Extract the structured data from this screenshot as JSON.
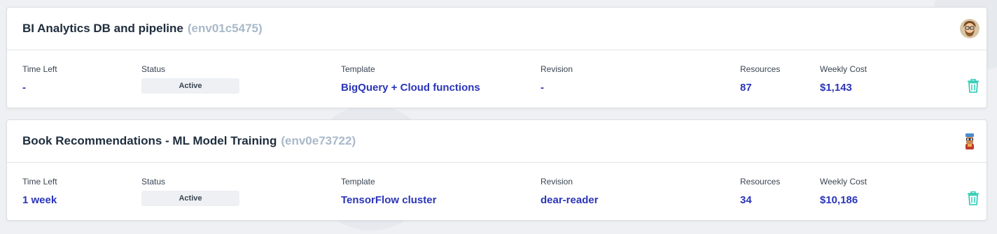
{
  "environments": [
    {
      "name": "BI Analytics DB and pipeline",
      "env_id": "(env01c5475)",
      "avatar_icon": "bearded-man-avatar",
      "labels": {
        "time_left": "Time Left",
        "status": "Status",
        "template": "Template",
        "revision": "Revision",
        "resources": "Resources",
        "weekly_cost": "Weekly Cost"
      },
      "time_left": "-",
      "status": "Active",
      "template": "BigQuery + Cloud functions",
      "revision": "-",
      "resources": "87",
      "weekly_cost": "$1,143"
    },
    {
      "name": "Book Recommendations - ML Model Training",
      "env_id": "(env0e73722)",
      "avatar_icon": "cartoon-character-avatar",
      "labels": {
        "time_left": "Time Left",
        "status": "Status",
        "template": "Template",
        "revision": "Revision",
        "resources": "Resources",
        "weekly_cost": "Weekly Cost"
      },
      "time_left": "1 week",
      "status": "Active",
      "template": "TensorFlow cluster",
      "revision": "dear-reader",
      "resources": "34",
      "weekly_cost": "$10,186"
    }
  ],
  "colors": {
    "value_link": "#2b35b8",
    "env_id": "#a9b9c9",
    "trash_icon": "#22c9b0"
  }
}
